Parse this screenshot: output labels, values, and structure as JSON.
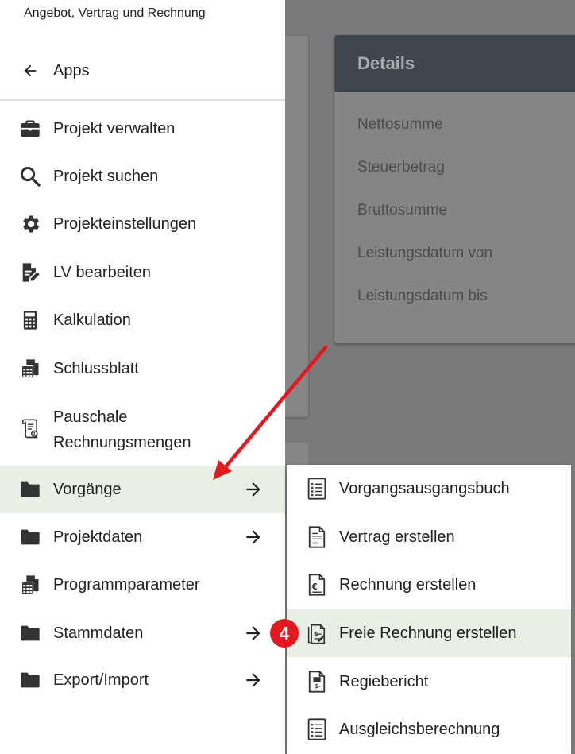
{
  "drawer": {
    "title": "Angebot, Vertrag und Rechnung",
    "apps_label": "Apps",
    "items": [
      {
        "label": "Projekt verwalten",
        "icon": "briefcase-icon"
      },
      {
        "label": "Projekt suchen",
        "icon": "search-icon"
      },
      {
        "label": "Projekteinstellungen",
        "icon": "gear-icon"
      },
      {
        "label": "LV bearbeiten",
        "icon": "document-edit-icon"
      },
      {
        "label": "Kalkulation",
        "icon": "calculator-icon"
      },
      {
        "label": "Schlussblatt",
        "icon": "spreadsheet-icon"
      },
      {
        "label_line1": "Pauschale",
        "label_line2": "Rechnungsmengen",
        "icon": "scroll-receipt-icon"
      },
      {
        "label": "Vorgänge",
        "icon": "folder-icon",
        "active": true
      },
      {
        "label": "Projektdaten",
        "icon": "folder-icon"
      },
      {
        "label": "Programmparameter",
        "icon": "spreadsheet-icon"
      },
      {
        "label": "Stammdaten",
        "icon": "folder-icon"
      },
      {
        "label": "Export/Import",
        "icon": "folder-icon"
      }
    ]
  },
  "submenu": {
    "items": [
      {
        "label": "Vorgangsausgangsbuch",
        "icon": "list-document-icon"
      },
      {
        "label": "Vertrag erstellen",
        "icon": "contract-icon"
      },
      {
        "label": "Rechnung erstellen",
        "icon": "invoice-euro-icon"
      },
      {
        "label": "Freie Rechnung erstellen",
        "icon": "free-invoice-icon",
        "active": true
      },
      {
        "label": "Regiebericht",
        "icon": "report-icon"
      },
      {
        "label": "Ausgleichsberechnung",
        "icon": "list-document-icon"
      }
    ]
  },
  "details": {
    "title": "Details",
    "rows": [
      "Nettosumme",
      "Steuerbetrag",
      "Bruttosumme",
      "Leistungsdatum von",
      "Leistungsdatum bis"
    ]
  },
  "annotation": {
    "step_number": "4",
    "color": "#e3191f"
  },
  "colors": {
    "active_bg": "#e9efe4",
    "details_header": "#3e474d",
    "overlay": "#7a7a7a"
  }
}
